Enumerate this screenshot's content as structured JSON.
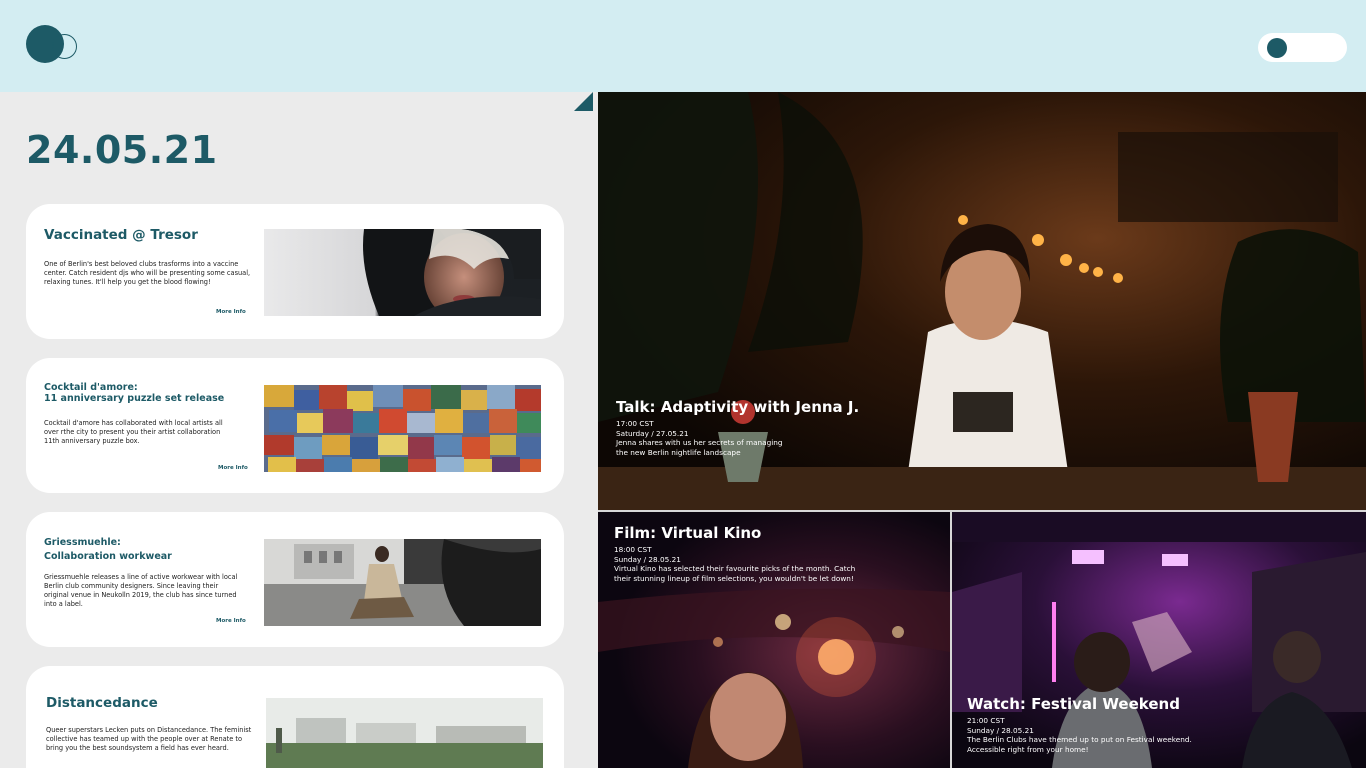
{
  "header": {
    "logo_icon": "two-circles-logo-icon",
    "toggle_icon": "theme-toggle-icon"
  },
  "date": "24.05.21",
  "events": [
    {
      "title": "Vaccinated @ Tresor",
      "description": "One of Berlin's best beloved clubs trasforms into a vaccine center. Catch resident djs who will be presenting some casual, relaxing tunes. It'll help you get the blood flowing!",
      "more": "More Info"
    },
    {
      "title_line1": "Cocktail d'amore:",
      "title_line2": "11 anniversary puzzle set release",
      "description": "Cocktail d'amore has collaborated with local artists all over rthe city to present you their artist collaboration 11th anniversary puzzle box.",
      "more": "More Info"
    },
    {
      "title_line1": "Griessmuehle:",
      "title_line2": "Collaboration workwear",
      "description": "Griessmuehle releases a line of active workwear with local Berlin club community designers. Since leaving their original venue in Neukolln 2019, the club has since turned into a label.",
      "more": "More Info"
    },
    {
      "title": "Distancedance",
      "description": "Queer superstars Lecken puts on Distancedance. The feminist collective has teamed up with the people over at Renate to bring you the best soundsystem a field has ever heard."
    }
  ],
  "features": [
    {
      "title": "Talk: Adaptivity with Jenna J.",
      "time": "17:00 CST",
      "day": "Saturday / 27.05.21",
      "description_line1": "Jenna shares with us her secrets of managing",
      "description_line2": "the new Berlin nightlife landscape"
    },
    {
      "title": "Film: Virtual Kino",
      "time": "18:00 CST",
      "day": "Sunday / 28.05.21",
      "description_line1": "Virtual Kino has selected their favourite picks of the month. Catch",
      "description_line2": "their stunning lineup of film selections, you wouldn't be let down!"
    },
    {
      "title": "Watch: Festival Weekend",
      "time": "21:00 CST",
      "day": "Sunday / 28.05.21",
      "description_line1": "The Berlin Clubs have themed up to put on Festival weekend.",
      "description_line2": "Accessible right from your home!"
    }
  ]
}
